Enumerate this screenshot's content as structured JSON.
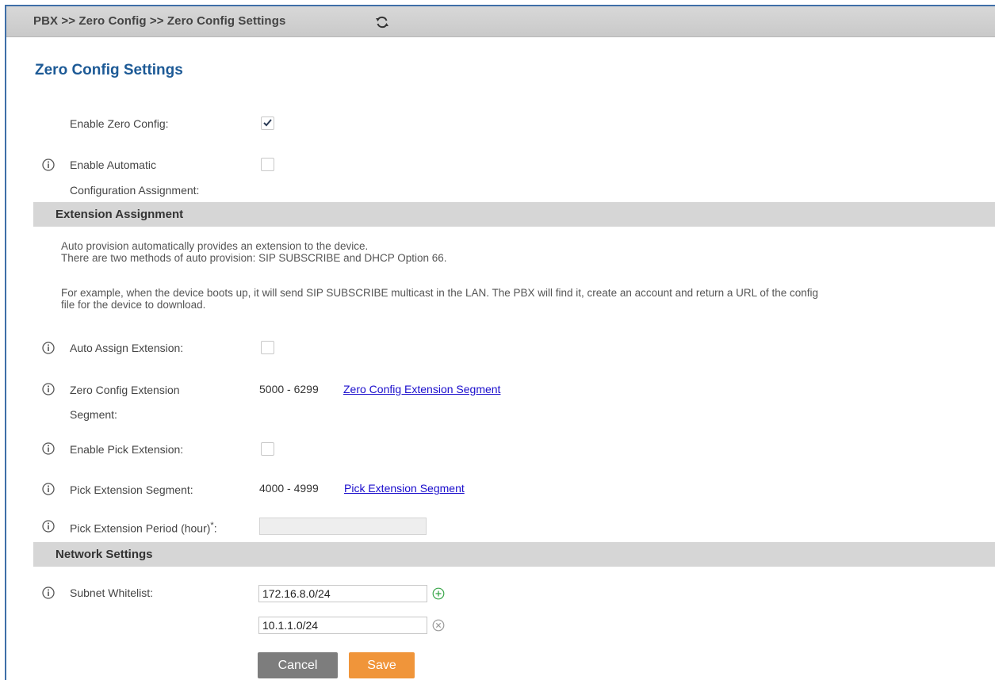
{
  "breadcrumb": "PBX >> Zero Config >> Zero Config Settings",
  "page_title": "Zero Config Settings",
  "fields": {
    "enable_zero_config": {
      "label": "Enable Zero Config:",
      "checked": true
    },
    "enable_auto_config": {
      "label_line1": "Enable Automatic",
      "label_line2": "Configuration Assignment:",
      "checked": false
    },
    "auto_assign_extension": {
      "label": "Auto Assign Extension:",
      "checked": false
    },
    "zero_config_segment": {
      "label_line1": "Zero Config Extension",
      "label_line2": "Segment:",
      "value": "5000 - 6299",
      "link": "Zero Config Extension Segment"
    },
    "enable_pick_extension": {
      "label": "Enable Pick Extension:",
      "checked": false
    },
    "pick_segment": {
      "label": "Pick Extension Segment:",
      "value": "4000 - 4999",
      "link": "Pick Extension Segment"
    },
    "pick_period": {
      "label": "Pick Extension Period (hour)",
      "required_mark": "*",
      "colon": ":",
      "value": ""
    },
    "subnet_whitelist": {
      "label": "Subnet Whitelist:",
      "entries": [
        "172.16.8.0/24",
        "10.1.1.0/24"
      ]
    }
  },
  "sections": {
    "extension_assignment": "Extension Assignment",
    "network_settings": "Network Settings"
  },
  "description": {
    "line1": "Auto provision automatically provides an extension to the device.",
    "line2": "There are two methods of auto provision: SIP SUBSCRIBE and DHCP Option 66.",
    "line3": "For example, when the device boots up, it will send SIP SUBSCRIBE multicast in the LAN. The PBX will find it, create an account and return a URL of the config",
    "line4": "file for the device to download."
  },
  "buttons": {
    "cancel": "Cancel",
    "save": "Save"
  },
  "colors": {
    "title_blue": "#1d5a96",
    "save_orange": "#f0953a",
    "cancel_gray": "#7d7d7d",
    "link_blue": "#1a0dcc",
    "add_green": "#3aa64a"
  },
  "icons": [
    "refresh-icon",
    "info-icon",
    "check-icon",
    "add-circle-icon",
    "remove-circle-icon"
  ]
}
